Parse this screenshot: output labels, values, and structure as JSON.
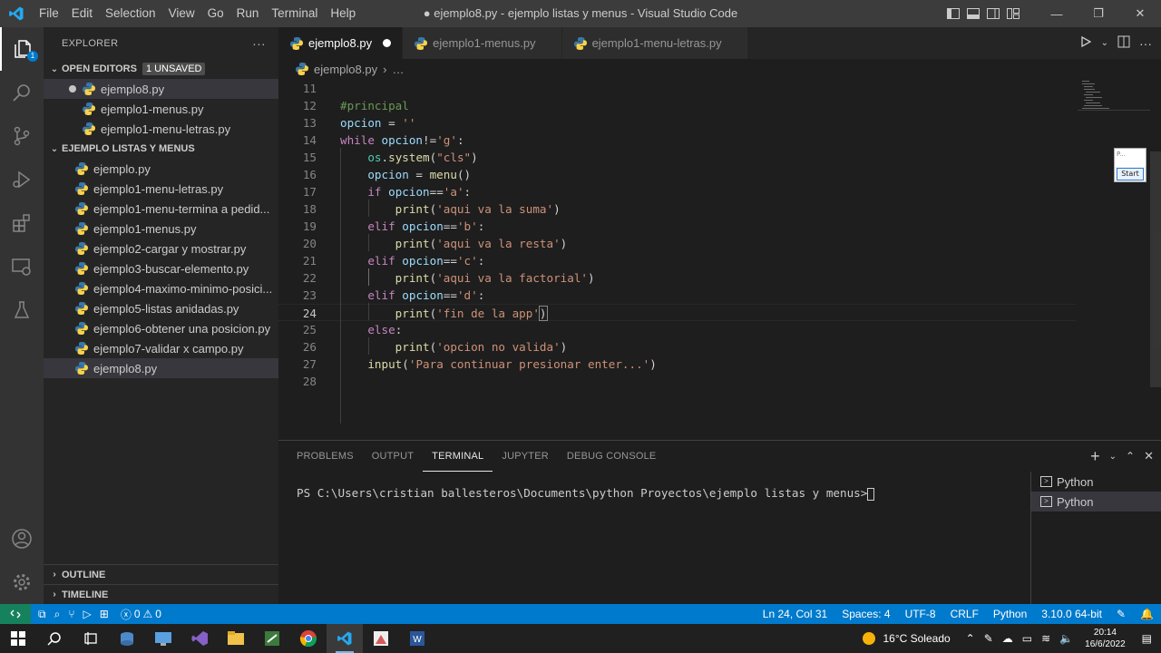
{
  "window": {
    "title": "● ejemplo8.py - ejemplo listas y menus - Visual Studio Code",
    "menu": [
      "File",
      "Edit",
      "Selection",
      "View",
      "Go",
      "Run",
      "Terminal",
      "Help"
    ]
  },
  "explorer": {
    "header": "EXPLORER",
    "more": "···",
    "open_editors": {
      "label": "OPEN EDITORS",
      "badge": "1 UNSAVED",
      "items": [
        "ejemplo8.py",
        "ejemplo1-menus.py",
        "ejemplo1-menu-letras.py"
      ]
    },
    "folder": {
      "label": "EJEMPLO LISTAS Y MENUS",
      "files": [
        "ejemplo.py",
        "ejemplo1-menu-letras.py",
        "ejemplo1-menu-termina a pedid...",
        "ejemplo1-menus.py",
        "ejemplo2-cargar y mostrar.py",
        "ejemplo3-buscar-elemento.py",
        "ejemplo4-maximo-minimo-posici...",
        "ejemplo5-listas anidadas.py",
        "ejemplo6-obtener una posicion.py",
        "ejemplo7-validar x campo.py",
        "ejemplo8.py"
      ]
    },
    "outline": "OUTLINE",
    "timeline": "TIMELINE"
  },
  "tabs": [
    "ejemplo8.py",
    "ejemplo1-menus.py",
    "ejemplo1-menu-letras.py"
  ],
  "breadcrumb": {
    "file": "ejemplo8.py",
    "rest": "…"
  },
  "code_lines": [
    {
      "n": "11",
      "html": ""
    },
    {
      "n": "12",
      "html": "<span style='color:#6a9955'>#principal</span>"
    },
    {
      "n": "13",
      "html": "<span style='color:#9cdcfe'>opcion</span> = <span style='color:#ce9178'>''</span>"
    },
    {
      "n": "14",
      "html": "<span style='color:#c586c0'>while</span> <span style='color:#9cdcfe'>opcion</span>!=<span style='color:#ce9178'>'g'</span>:"
    },
    {
      "n": "15",
      "html": "    <span style='color:#4ec9b0'>os</span>.<span style='color:#dcdcaa'>system</span>(<span style='color:#ce9178'>\"cls\"</span>)"
    },
    {
      "n": "16",
      "html": "    <span style='color:#9cdcfe'>opcion</span> = <span style='color:#dcdcaa'>menu</span>()"
    },
    {
      "n": "17",
      "html": "    <span style='color:#c586c0'>if</span> <span style='color:#9cdcfe'>opcion</span>==<span style='color:#ce9178'>'a'</span>:"
    },
    {
      "n": "18",
      "html": "        <span style='color:#dcdcaa'>print</span>(<span style='color:#ce9178'>'aqui va la suma'</span>)"
    },
    {
      "n": "19",
      "html": "    <span style='color:#c586c0'>elif</span> <span style='color:#9cdcfe'>opcion</span>==<span style='color:#ce9178'>'b'</span>:"
    },
    {
      "n": "20",
      "html": "        <span style='color:#dcdcaa'>print</span>(<span style='color:#ce9178'>'aqui va la resta'</span>)"
    },
    {
      "n": "21",
      "html": "    <span style='color:#c586c0'>elif</span> <span style='color:#9cdcfe'>opcion</span>==<span style='color:#ce9178'>'c'</span>:"
    },
    {
      "n": "22",
      "html": "        <span style='color:#dcdcaa'>print</span>(<span style='color:#ce9178'>'aqui va la factorial'</span>)"
    },
    {
      "n": "23",
      "html": "    <span style='color:#c586c0'>elif</span> <span style='color:#9cdcfe'>opcion</span>==<span style='color:#ce9178'>'d'</span>:"
    },
    {
      "n": "24",
      "html": "        <span style='color:#dcdcaa'>print</span>(<span style='color:#ce9178'>'fin de la app'</span><span style='outline:1px solid #888'>)</span>"
    },
    {
      "n": "25",
      "html": "    <span style='color:#c586c0'>else</span>:"
    },
    {
      "n": "26",
      "html": "        <span style='color:#dcdcaa'>print</span>(<span style='color:#ce9178'>'opcion no valida'</span>)"
    },
    {
      "n": "27",
      "html": "    <span style='color:#dcdcaa'>input</span>(<span style='color:#ce9178'>'Para continuar presionar enter...'</span>)"
    },
    {
      "n": "28",
      "html": ""
    }
  ],
  "start_widget": {
    "top": "P...",
    "button": "Start"
  },
  "panel": {
    "tabs": [
      "PROBLEMS",
      "OUTPUT",
      "TERMINAL",
      "JUPYTER",
      "DEBUG CONSOLE"
    ],
    "active_tab": "TERMINAL",
    "prompt": "PS C:\\Users\\cristian ballesteros\\Documents\\python Proyectos\\ejemplo listas y menus>",
    "terminals": [
      "Python",
      "Python"
    ]
  },
  "status": {
    "errors": "0",
    "warnings": "0",
    "position": "Ln 24, Col 31",
    "spaces": "Spaces: 4",
    "encoding": "UTF-8",
    "eol": "CRLF",
    "language": "Python",
    "interpreter": "3.10.0 64-bit"
  },
  "taskbar": {
    "weather": "16°C  Soleado",
    "time": "20:14",
    "date": "16/6/2022"
  },
  "colors": {
    "accent": "#007acc",
    "remote": "#16825d",
    "sidebar": "#252526",
    "editor": "#1e1e1e"
  }
}
